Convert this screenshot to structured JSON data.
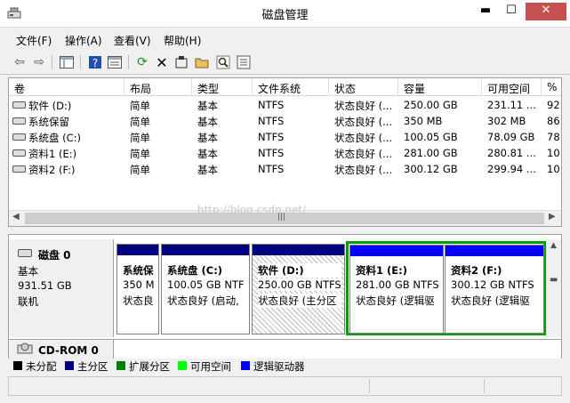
{
  "window": {
    "title": "磁盘管理",
    "min": "▬",
    "max": "☐",
    "close": "✕"
  },
  "menu": [
    {
      "label": "文件(F)"
    },
    {
      "label": "操作(A)"
    },
    {
      "label": "查看(V)"
    },
    {
      "label": "帮助(H)"
    }
  ],
  "toolbar": {
    "icons": [
      "back-icon",
      "forward-icon",
      "console-tree-icon",
      "help-icon",
      "properties-list-icon",
      "refresh-icon",
      "delete-icon",
      "properties-icon",
      "open-icon",
      "search-icon",
      "export-icon"
    ]
  },
  "volume_table": {
    "headers": [
      "卷",
      "布局",
      "类型",
      "文件系统",
      "状态",
      "容量",
      "可用空间",
      "%"
    ],
    "rows": [
      [
        "软件 (D:)",
        "简单",
        "基本",
        "NTFS",
        "状态良好 (...",
        "250.00 GB",
        "231.11 ...",
        "92"
      ],
      [
        "系统保留",
        "简单",
        "基本",
        "NTFS",
        "状态良好 (...",
        "350 MB",
        "302 MB",
        "86"
      ],
      [
        "系统盘 (C:)",
        "简单",
        "基本",
        "NTFS",
        "状态良好 (...",
        "100.05 GB",
        "78.09 GB",
        "78"
      ],
      [
        "资料1 (E:)",
        "简单",
        "基本",
        "NTFS",
        "状态良好 (...",
        "281.00 GB",
        "280.81 ...",
        "10"
      ],
      [
        "资料2 (F:)",
        "简单",
        "基本",
        "NTFS",
        "状态良好 (...",
        "300.12 GB",
        "299.94 ...",
        "10"
      ]
    ]
  },
  "watermark": "http://blog.csdn.net/",
  "disk0": {
    "name": "磁盘 0",
    "type": "基本",
    "size": "931.51 GB",
    "status": "联机"
  },
  "partitions": [
    {
      "name": "系统保",
      "size": "350 M",
      "status": "状态良"
    },
    {
      "name": "系统盘 (C:)",
      "size": "100.05 GB NTF",
      "status": "状态良好 (启动,"
    },
    {
      "name": "软件  (D:)",
      "size": "250.00 GB NTFS",
      "status": "状态良好 (主分区"
    },
    {
      "name": "资料1  (E:)",
      "size": "281.00 GB NTFS",
      "status": "状态良好 (逻辑驱"
    },
    {
      "name": "资料2  (F:)",
      "size": "300.12 GB NTFS",
      "status": "状态良好 (逻辑驱"
    }
  ],
  "cdrom": {
    "name": "CD-ROM 0"
  },
  "legend": [
    {
      "label": "未分配",
      "color": "#000000"
    },
    {
      "label": "主分区",
      "color": "#000080"
    },
    {
      "label": "扩展分区",
      "color": "#008000"
    },
    {
      "label": "可用空间",
      "color": "#00ff00"
    },
    {
      "label": "逻辑驱动器",
      "color": "#0000ff"
    }
  ],
  "colors": {
    "primary": "#000080",
    "logical": "#0000ff",
    "extended": "#00a000"
  }
}
